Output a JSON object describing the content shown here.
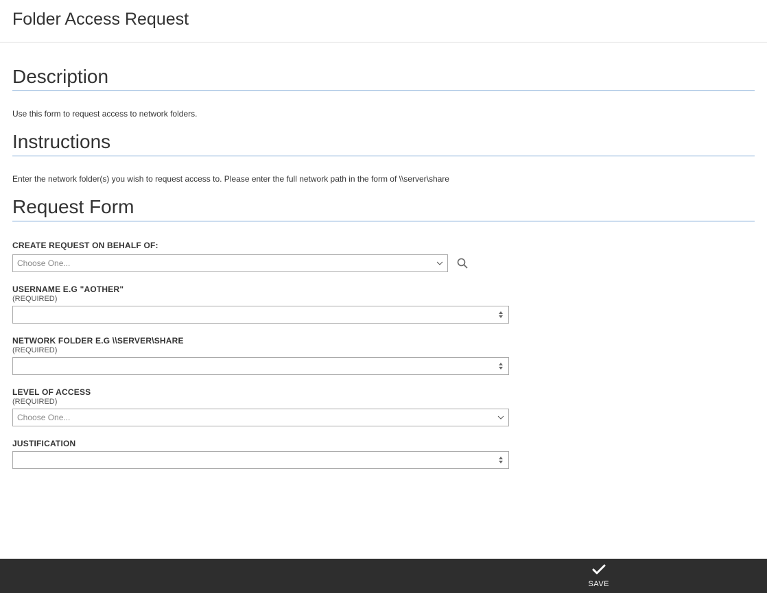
{
  "header": {
    "title": "Folder Access Request"
  },
  "sections": {
    "description": {
      "heading": "Description",
      "text": "Use this form to request access to network folders."
    },
    "instructions": {
      "heading": "Instructions",
      "text": "Enter the network folder(s) you wish to request access to. Please enter the full network path in the form of \\\\server\\share"
    },
    "requestForm": {
      "heading": "Request Form"
    }
  },
  "form": {
    "behalfOf": {
      "label": "CREATE REQUEST ON BEHALF OF:",
      "placeholder": "Choose One..."
    },
    "username": {
      "label": "USERNAME E.G \"AOTHER\"",
      "required": "(REQUIRED)",
      "value": ""
    },
    "networkFolder": {
      "label": "NETWORK FOLDER E.G \\\\SERVER\\SHARE",
      "required": "(REQUIRED)",
      "value": ""
    },
    "accessLevel": {
      "label": "LEVEL OF ACCESS",
      "required": "(REQUIRED)",
      "placeholder": "Choose One..."
    },
    "justification": {
      "label": "JUSTIFICATION",
      "value": ""
    }
  },
  "footer": {
    "saveLabel": "SAVE"
  }
}
